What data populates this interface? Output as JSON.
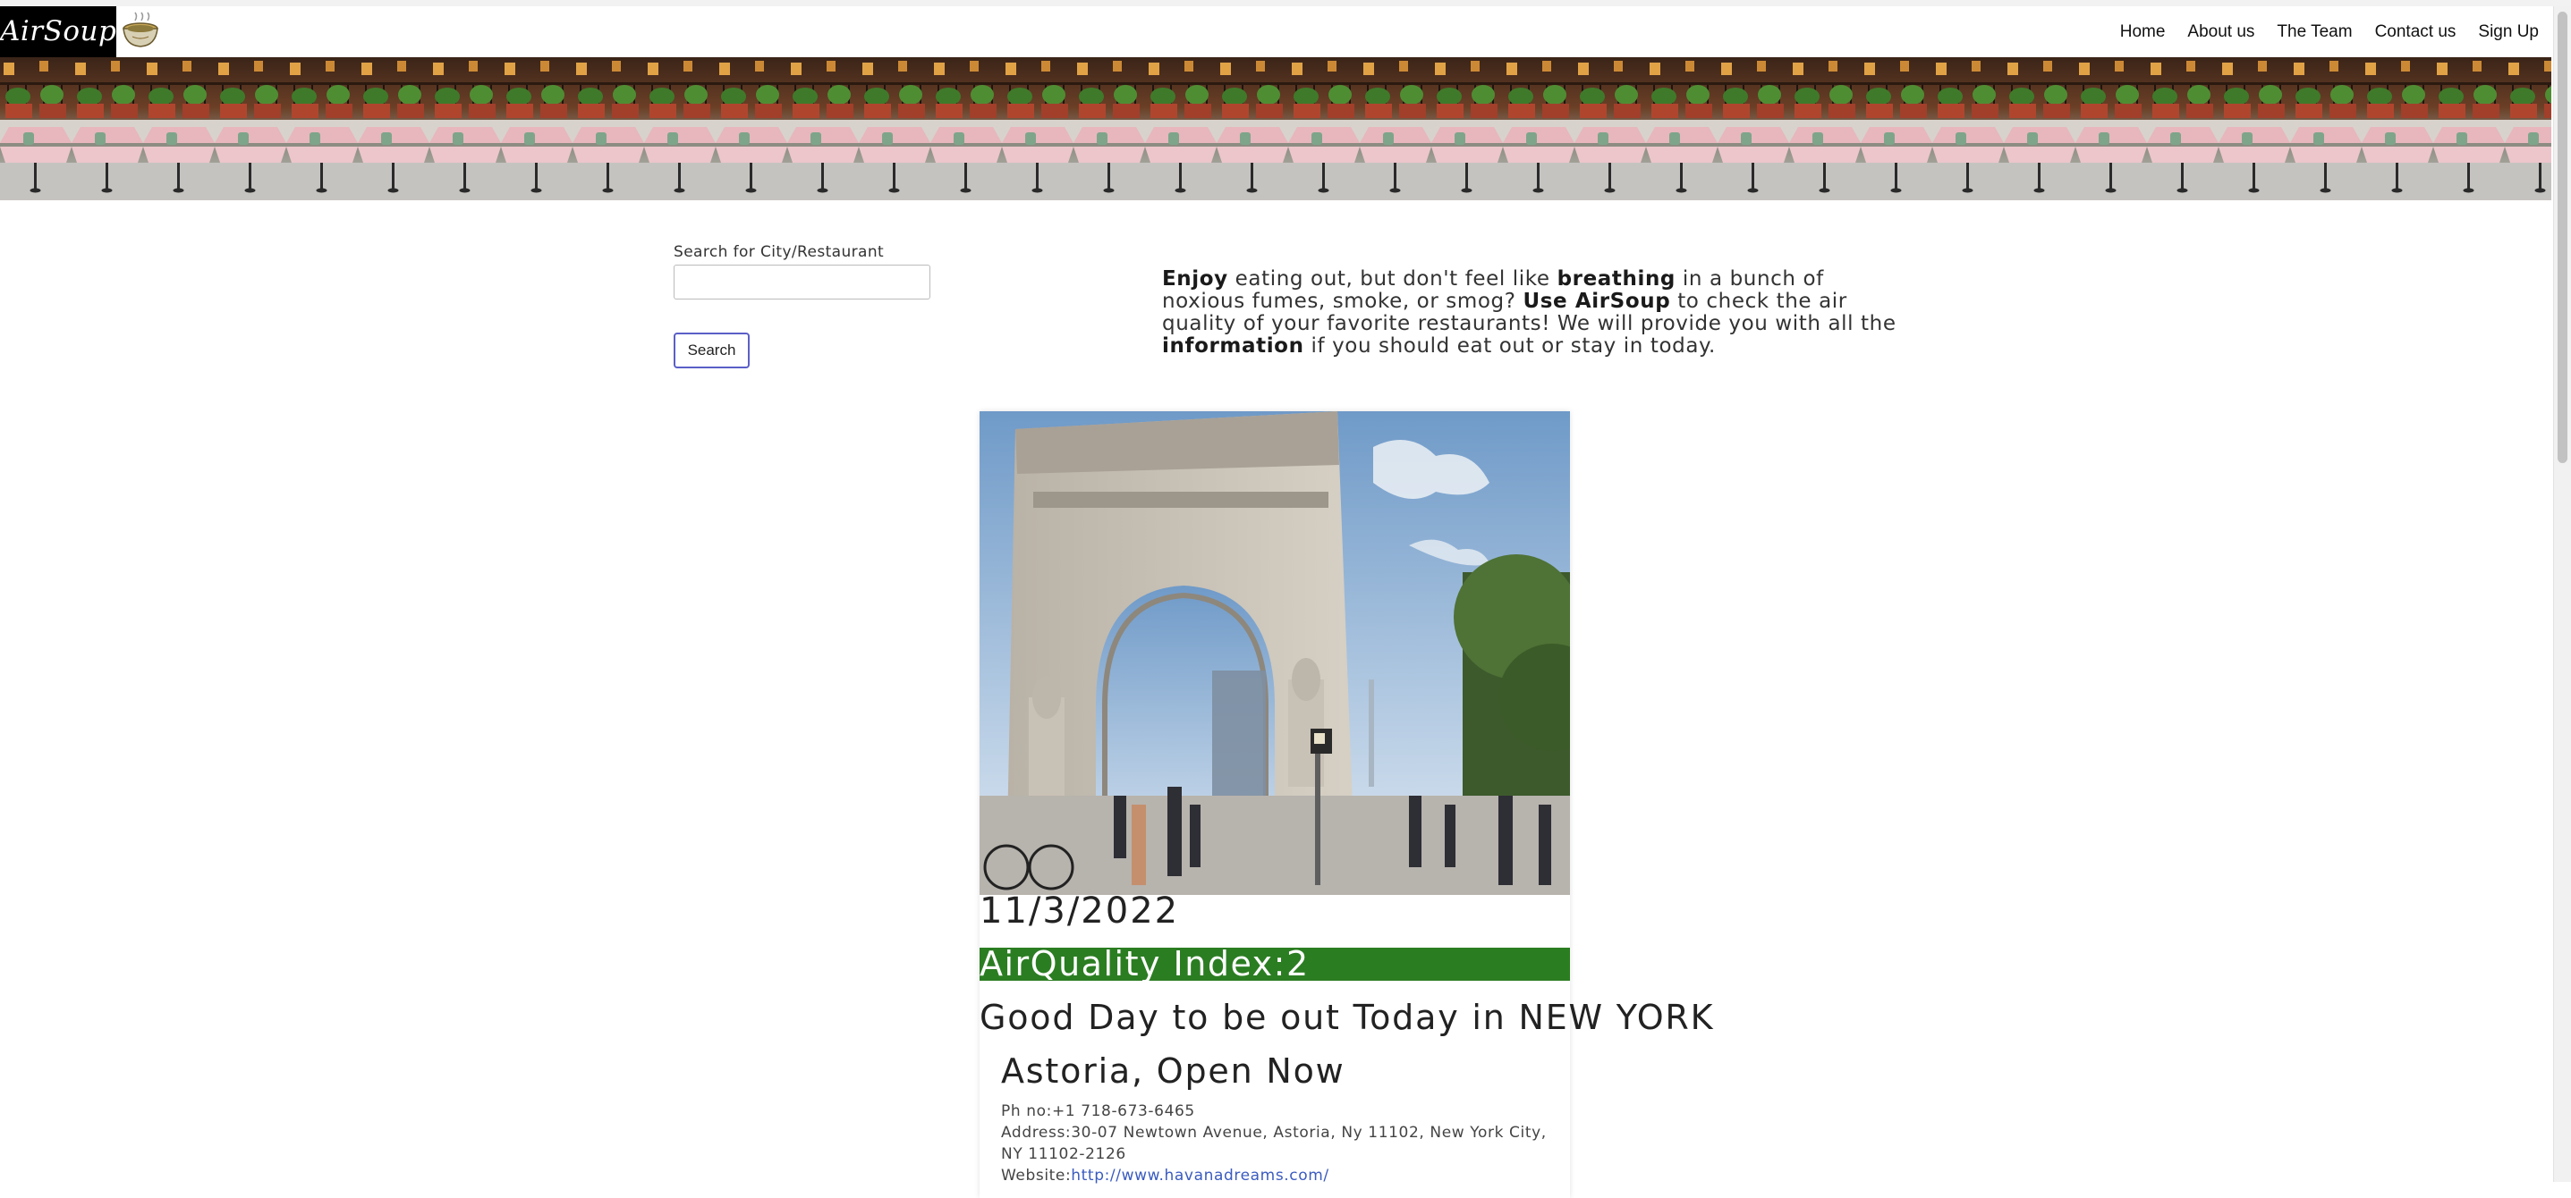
{
  "brand": {
    "logo_text": "AirSoup."
  },
  "nav": {
    "items": [
      "Home",
      "About us",
      "The Team",
      "Contact us",
      "Sign Up"
    ]
  },
  "search": {
    "label": "Search for City/Restaurant",
    "value": "",
    "placeholder": "",
    "button_label": "Search"
  },
  "intro": {
    "w1": "Enjoy",
    "t1": " eating out, but don't feel like ",
    "w2": "breathing",
    "t2": " in a bunch of noxious fumes, smoke, or smog? ",
    "w3": "Use AirSoup",
    "t3": " to check the air quality of your favorite restaurants! We will provide you with all the ",
    "w4": "information",
    "t4": " if you should eat out or stay in today."
  },
  "card": {
    "date": "11/3/2022",
    "aqi_label": "AirQuality Index:2",
    "aqi_color": "#2b7d22",
    "status": "Good Day to be out Today in NEW YORK",
    "restaurant": {
      "name": "Astoria, Open Now",
      "phone_label": "Ph no:",
      "phone": "+1 718-673-6465",
      "address_label": "Address:",
      "address": "30-07 Newtown Avenue, Astoria, Ny 11102, New York City, NY 11102-2126",
      "website_label": "Website:",
      "website": "http://www.havanadreams.com/"
    }
  }
}
